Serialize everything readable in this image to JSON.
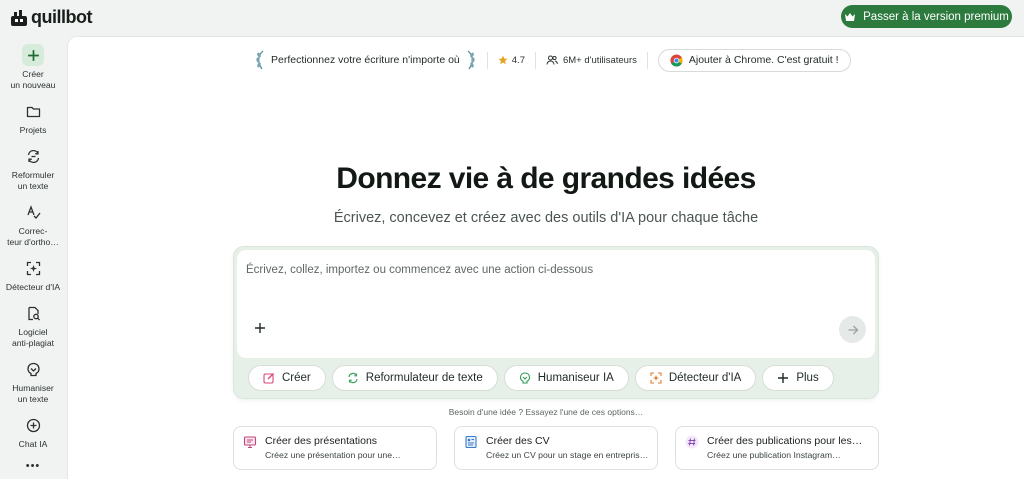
{
  "brand": {
    "name": "quillbot"
  },
  "header": {
    "premium_label": "Passer à la version premium",
    "premium_color": "#2c7a3d"
  },
  "sidebar": {
    "items": [
      {
        "line1": "Créer",
        "line2": "un nouveau",
        "icon": "plus-icon"
      },
      {
        "line1": "Projets",
        "line2": "",
        "icon": "folder-icon"
      },
      {
        "line1": "Reformuler",
        "line2": "un texte",
        "icon": "paraphrase-icon"
      },
      {
        "line1": "Correc-",
        "line2": "teur d'ortho…",
        "icon": "spellcheck-icon"
      },
      {
        "line1": "Détecteur d'IA",
        "line2": "",
        "icon": "ai-detector-icon"
      },
      {
        "line1": "Logiciel",
        "line2": "anti-plagiat",
        "icon": "plagiarism-icon"
      },
      {
        "line1": "Humaniser",
        "line2": "un texte",
        "icon": "humanizer-icon"
      },
      {
        "line1": "Chat IA",
        "line2": "",
        "icon": "chat-icon"
      }
    ],
    "more_label": "•••"
  },
  "promo": {
    "title": "Perfectionnez votre écriture n'importe où",
    "rating": "4.7",
    "users": "6M+ d'utilisateurs",
    "chrome_cta": "Ajouter à Chrome. C'est gratuit !"
  },
  "hero": {
    "title": "Donnez vie à de grandes idées",
    "subtitle": "Écrivez, concevez et créez avec des outils d'IA pour chaque tâche"
  },
  "composer": {
    "placeholder": "Écrivez, collez, importez ou commencez avec une action ci-dessous",
    "chips": [
      {
        "label": "Créer",
        "icon": "edit-icon"
      },
      {
        "label": "Reformulateur de texte",
        "icon": "paraphrase-icon"
      },
      {
        "label": "Humaniseur IA",
        "icon": "humanizer-icon"
      },
      {
        "label": "Détecteur d'IA",
        "icon": "ai-detector-icon"
      },
      {
        "label": "Plus",
        "icon": "plus-icon"
      }
    ]
  },
  "suggestions": {
    "hint": "Besoin d'une idée ? Essayez l'une de ces options…",
    "cards": [
      {
        "title": "Créer des présentations",
        "desc": "Créez une présentation pour une…",
        "icon": "presentation-icon"
      },
      {
        "title": "Créer des CV",
        "desc": "Créez un CV pour un stage en entrepris…",
        "icon": "resume-icon"
      },
      {
        "title": "Créer des publications pour les…",
        "desc": "Créez une publication Instagram…",
        "icon": "hashtag-icon"
      }
    ]
  }
}
